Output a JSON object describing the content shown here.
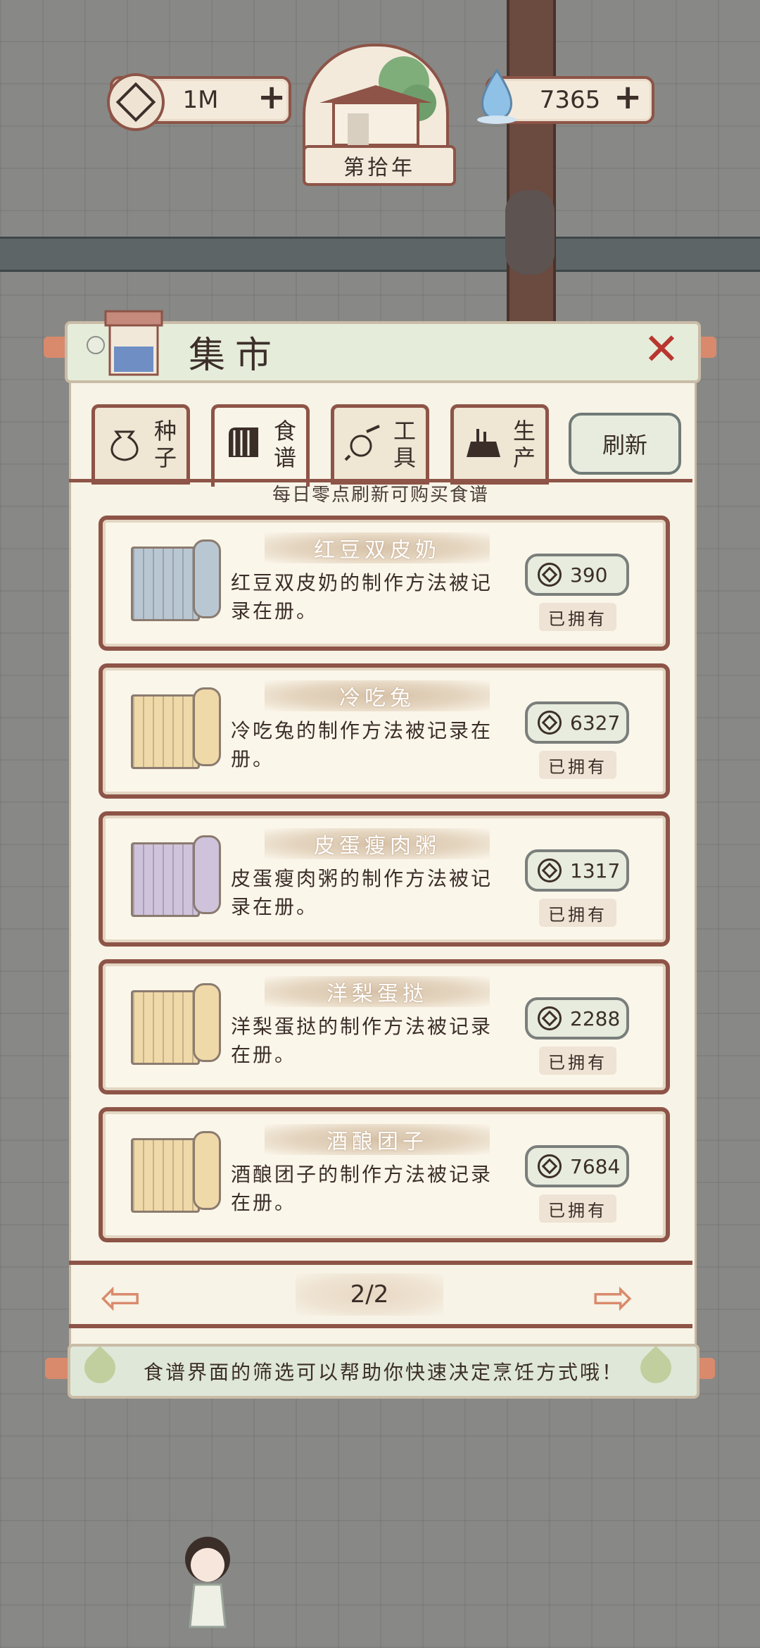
{
  "hud": {
    "coins": "1M",
    "spirit": "7365",
    "year": "第拾年"
  },
  "market": {
    "title": "集市",
    "tabs": [
      {
        "label": "种子",
        "active": false
      },
      {
        "label": "食谱",
        "active": true
      },
      {
        "label": "工具",
        "active": false
      },
      {
        "label": "生产",
        "active": false
      }
    ],
    "refresh_label": "刷新",
    "notice": "每日零点刷新可购买食谱",
    "items": [
      {
        "name": "红豆双皮奶",
        "desc": "红豆双皮奶的制作方法被记录在册。",
        "price": "390",
        "status": "已拥有",
        "scroll_color": "#b9c7d3"
      },
      {
        "name": "冷吃兔",
        "desc": "冷吃兔的制作方法被记录在册。",
        "price": "6327",
        "status": "已拥有",
        "scroll_color": "#f0d9a8"
      },
      {
        "name": "皮蛋瘦肉粥",
        "desc": "皮蛋瘦肉粥的制作方法被记录在册。",
        "price": "1317",
        "status": "已拥有",
        "scroll_color": "#cfc3dc"
      },
      {
        "name": "洋梨蛋挞",
        "desc": "洋梨蛋挞的制作方法被记录在册。",
        "price": "2288",
        "status": "已拥有",
        "scroll_color": "#f0d9a8"
      },
      {
        "name": "酒酿团子",
        "desc": "酒酿团子的制作方法被记录在册。",
        "price": "7684",
        "status": "已拥有",
        "scroll_color": "#f0d9a8"
      }
    ],
    "page": "2/2",
    "tip": "食谱界面的筛选可以帮助你快速决定烹饪方式哦！"
  }
}
